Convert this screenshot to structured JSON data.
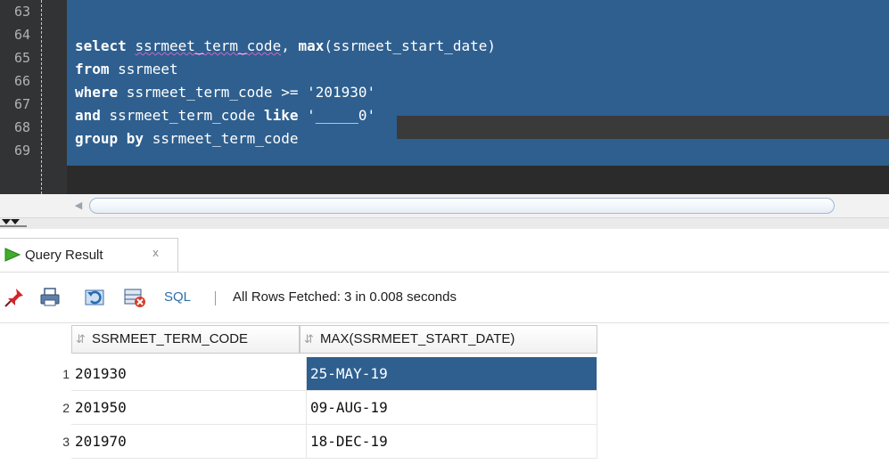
{
  "editor": {
    "line_numbers": [
      "63",
      "64",
      "65",
      "66",
      "67",
      "68",
      "69"
    ],
    "lines": {
      "l64_a": "select",
      "l64_b": " ",
      "l64_c": "ssrmeet_term_code",
      "l64_d": ", ",
      "l64_e": "max",
      "l64_f": "(ssrmeet_start_date)",
      "l65_a": "from",
      "l65_b": " ssrmeet",
      "l66_a": "where",
      "l66_b": " ssrmeet_term_code >= ",
      "l66_c": "'201930'",
      "l67_a": "and",
      "l67_b": " ssrmeet_term_code ",
      "l67_c": "like",
      "l67_d": " ",
      "l67_e": "'_____0'",
      "l68_a": "group by",
      "l68_b": " ssrmeet_term_code"
    }
  },
  "result_panel": {
    "tab_label": "Query Result",
    "tab_close": "x",
    "toolbar": {
      "sql_label": "SQL",
      "status": "All Rows Fetched: 3 in 0.008 seconds"
    },
    "columns": [
      "SSRMEET_TERM_CODE",
      "MAX(SSRMEET_START_DATE)"
    ],
    "rows": [
      {
        "num": "1",
        "term_code": "201930",
        "max_start_date": "25-MAY-19"
      },
      {
        "num": "2",
        "term_code": "201950",
        "max_start_date": "09-AUG-19"
      },
      {
        "num": "3",
        "term_code": "201970",
        "max_start_date": "18-DEC-19"
      }
    ]
  },
  "colors": {
    "editor_bg": "#2b2b2b",
    "selection": "#2e5f8f",
    "sql_link": "#2f6ea6"
  },
  "icons": [
    "run-arrow-icon",
    "pin-icon",
    "print-icon",
    "refresh-icon",
    "delete-grid-icon",
    "sort-icon"
  ]
}
